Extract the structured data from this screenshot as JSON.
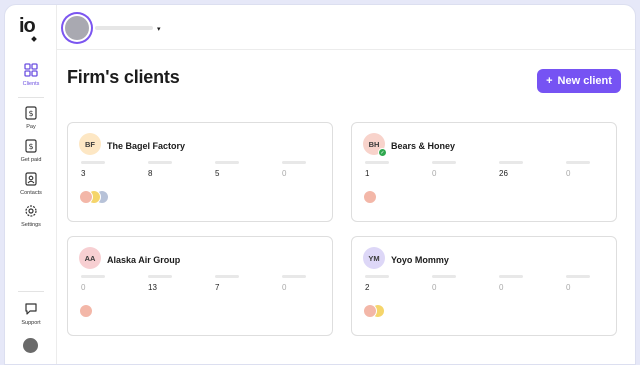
{
  "sidebar": {
    "logo": "io",
    "items": [
      {
        "label": "Clients",
        "icon": "grid-icon",
        "active": true
      },
      {
        "label": "Pay",
        "icon": "dollar-doc-icon"
      },
      {
        "label": "Get paid",
        "icon": "dollar-doc-icon"
      },
      {
        "label": "Contacts",
        "icon": "contact-book-icon"
      },
      {
        "label": "Settings",
        "icon": "gear-icon"
      }
    ],
    "support_label": "Support"
  },
  "page": {
    "title": "Firm's clients",
    "new_client_label": "New client",
    "accent": "#7653f3"
  },
  "clients": [
    {
      "initials": "BF",
      "name": "The Bagel Factory",
      "avatar_color": "#fde7c4",
      "stats": [
        "3",
        "8",
        "5",
        "0"
      ],
      "badge": false
    },
    {
      "initials": "BH",
      "name": "Bears & Honey",
      "avatar_color": "#f8d3cb",
      "stats": [
        "1",
        "0",
        "26",
        "0"
      ],
      "badge": true
    },
    {
      "initials": "AA",
      "name": "Alaska Air Group",
      "avatar_color": "#f7cfd2",
      "stats": [
        "0",
        "13",
        "7",
        "0"
      ],
      "badge": false
    },
    {
      "initials": "YM",
      "name": "Yoyo Mommy",
      "avatar_color": "#ddd7f7",
      "stats": [
        "2",
        "0",
        "0",
        "0"
      ],
      "badge": false
    }
  ]
}
